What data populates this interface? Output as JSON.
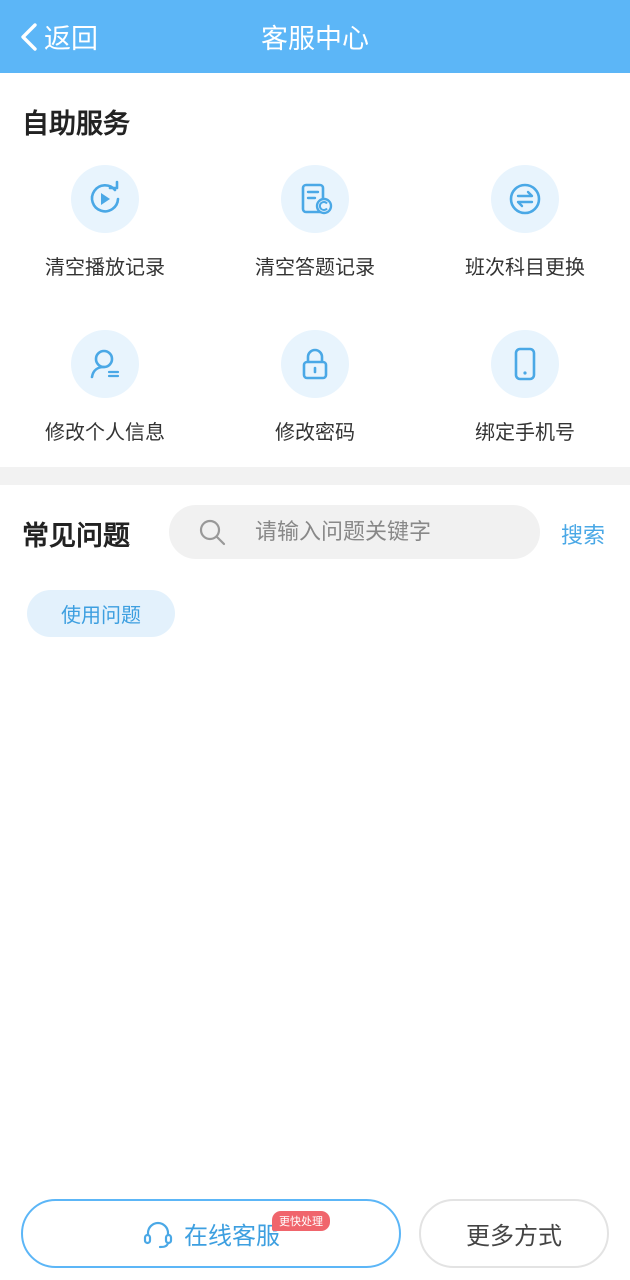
{
  "header": {
    "back_label": "返回",
    "title": "客服中心"
  },
  "self_service": {
    "title": "自助服务",
    "items": [
      {
        "label": "清空播放记录",
        "icon": "replay-icon"
      },
      {
        "label": "清空答题记录",
        "icon": "clear-answers-icon"
      },
      {
        "label": "班次科目更换",
        "icon": "switch-icon"
      },
      {
        "label": "修改个人信息",
        "icon": "user-edit-icon"
      },
      {
        "label": "修改密码",
        "icon": "lock-icon"
      },
      {
        "label": "绑定手机号",
        "icon": "phone-icon"
      }
    ]
  },
  "faq": {
    "title": "常见问题",
    "search_placeholder": "请输入问题关键字",
    "search_button": "搜索",
    "tags": [
      "使用问题"
    ]
  },
  "footer": {
    "online_label": "在线客服",
    "online_badge": "更快处理",
    "more_label": "更多方式"
  },
  "colors": {
    "primary": "#5cb6f7",
    "accent_text": "#3d9fe0",
    "icon_bg": "#e8f4fd",
    "badge": "#f0656c"
  }
}
